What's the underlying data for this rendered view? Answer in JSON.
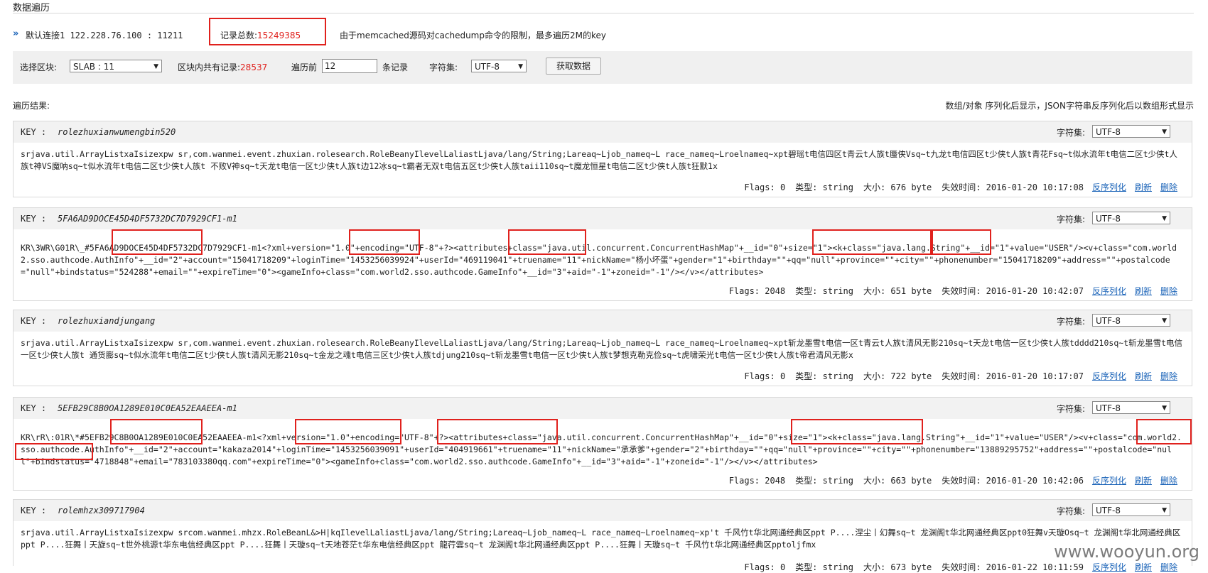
{
  "page_title": "数据遍历",
  "connection": {
    "arrow": "»",
    "label": "默认连接1  122.228.76.100 : 11211",
    "count_label": "记录总数:",
    "count_value": "15249385",
    "note": "由于memcached源码对cachedump命令的限制，最多遍历2M的key"
  },
  "filter": {
    "slab_label": "选择区块:",
    "slab_value": "SLAB : 11",
    "records_label": "区块内共有记录:",
    "records_value": "28537",
    "traverse_label": "遍历前",
    "traverse_value": "12",
    "traverse_suffix": "条记录",
    "charset_label": "字符集:",
    "charset_value": "UTF-8",
    "fetch_button": "获取数据"
  },
  "results_label": "遍历结果:",
  "results_hint": "数组/对象 序列化后显示，JSON字符串反序列化后以数组形式显示",
  "common": {
    "key_label": "KEY :",
    "charset_label": "字符集:",
    "charset_value": "UTF-8",
    "deserialize": "反序列化",
    "refresh": "刷新",
    "delete": "删除"
  },
  "records": [
    {
      "key": "rolezhuxianwumengbin520",
      "value": "srjava.util.ArrayListxaIsizexpw sr,com.wanmei.event.zhuxian.rolesearch.RoleBeanyIlevelLaliastLjava/lang/String;Lareaq~Ljob_nameq~L race_nameq~Lroelnameq~xpt碧瑶t电信四区t青云t人族t蜃侠Vsq~t九龙t电信四区t少侠t人族t青花Fsq~t似水流年t电信二区t少侠t人族t神VS魔呐sq~t似水流年t电信二区t少侠t人族t 不败V神sq~t天龙t电信一区t少侠t人族t边12冰sq~t霸者无双t电信五区t少侠t人族taii110sq~t魔龙恒星t电信二区t少侠t人族t狂默1x",
      "flags": "Flags: 0",
      "type": "类型: string",
      "size": "大小: 676  byte",
      "expire": "失效时间: 2016-01-20 10:17:08"
    },
    {
      "key": "5FA6AD9DOCE45D4DF5732DC7D7929CF1-m1",
      "value": "KR\\3WR\\G01R\\_#5FA6AD9DOCE45D4DF5732DC7D7929CF1-m1<?xml+version=\"1.0\"+encoding=\"UTF-8\"+?><attributes+class=\"java.util.concurrent.ConcurrentHashMap\"+__id=\"0\"+size=\"1\"><k+class=\"java.lang.String\"+__id=\"1\"+value=\"USER\"/><v+class=\"com.world2.sso.authcode.AuthInfo\"+__id=\"2\"+account=\"15041718209\"+loginTime=\"1453256039924\"+userId=\"469119041\"+truename=\"11\"+nickName=\"杨小坏蛋\"+gender=\"1\"+birthday=\"\"+qq=\"null\"+province=\"\"+city=\"\"+phonenumber=\"15041718209\"+address=\"\"+postalcode=\"null\"+bindstatus=\"524288\"+email=\"\"+expireTime=\"0\"><gameInfo+class=\"com.world2.sso.authcode.GameInfo\"+__id=\"3\"+aid=\"-1\"+zoneid=\"-1\"/></v></attributes>",
      "flags": "Flags: 2048",
      "type": "类型: string",
      "size": "大小: 651  byte",
      "expire": "失效时间: 2016-01-20 10:42:07"
    },
    {
      "key": "rolezhuxiandjungang",
      "value": "srjava.util.ArrayListxaIsizexpw sr,com.wanmei.event.zhuxian.rolesearch.RoleBeanyIlevelLaliastLjava/lang/String;Lareaq~Ljob_nameq~L race_nameq~Lroelnameq~xpt斩龙墨雪t电信一区t青云t人族t清风无影210sq~t天龙t电信一区t少侠t人族tdddd210sq~t斩龙墨雪t电信一区t少侠t人族t 通货膨sq~t似水流年t电信二区t少侠t人族t清风无影210sq~t金龙之魂t电信三区t少侠t人族tdjung210sq~t斩龙墨雪t电信一区t少侠t人族t梦想克勒克俭sq~t虎啸荣光t电信一区t少侠t人族t帝君清风无影x",
      "flags": "Flags: 0",
      "type": "类型: string",
      "size": "大小: 722  byte",
      "expire": "失效时间: 2016-01-20 10:17:07"
    },
    {
      "key": "5EFB29C8B0OA1289E010C0EA52EAAEEA-m1",
      "value": "KR\\rR\\:01R\\*#5EFB29C8B0OA1289E010C0EA52EAAEEA-m1<?xml+version=\"1.0\"+encoding=\"UTF-8\"+?><attributes+class=\"java.util.concurrent.ConcurrentHashMap\"+__id=\"0\"+size=\"1\"><k+class=\"java.lang.String\"+__id=\"1\"+value=\"USER\"/><v+class=\"com.world2.sso.authcode.AuthInfo\"+__id=\"2\"+account=\"kakaza2014\"+loginTime=\"1453256039091\"+userId=\"404919661\"+truename=\"11\"+nickName=\"承承爹\"+gender=\"2\"+birthday=\"\"+qq=\"null\"+province=\"\"+city=\"\"+phonenumber=\"13889295752\"+address=\"\"+postalcode=\"null\"+bindstatus=\"4718848\"+email=\"783103380qq.com\"+expireTime=\"0\"><gameInfo+class=\"com.world2.sso.authcode.GameInfo\"+__id=\"3\"+aid=\"-1\"+zoneid=\"-1\"/></v></attributes>",
      "flags": "Flags: 2048",
      "type": "类型: string",
      "size": "大小: 663  byte",
      "expire": "失效时间: 2016-01-20 10:42:06"
    },
    {
      "key": "rolemhzx309717904",
      "value": "srjava.util.ArrayListxaIsizexpw srcom.wanmei.mhzx.RoleBeanL&>H|kqIlevelLaliastLjava/lang/String;Lareaq~Ljob_nameq~L race_nameq~Lroelnameq~xp't 千风竹t华北网通经典区ppt P....涅尘丨幻舞sq~t 龙渊阁t华北网通经典区ppt0狂舞v天璇Osq~t 龙渊阁t华北网通经典区ppt P....狂舞丨天旋sq~t世外桃源t华东电信经典区ppt P....狂舞丨天璇sq~t天地苍茫t华东电信经典区ppt 龍荇雲sq~t 龙渊阁t华北网通经典区ppt P....狂舞丨天璇sq~t 千风竹t华北网通经典区pptoljfmx",
      "flags": "Flags: 0",
      "type": "类型: string",
      "size": "大小: 673  byte",
      "expire": "失效时间: 2016-01-22 10:11:59"
    }
  ],
  "watermark": "www.wooyun.org"
}
